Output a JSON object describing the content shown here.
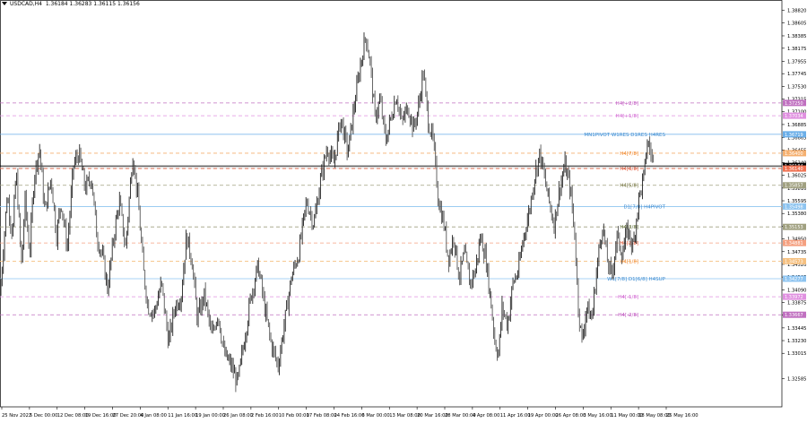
{
  "header": {
    "symbol_tf": "USDCAD,H4",
    "ohlc": "1.36184 1.36283 1.36115 1.36156"
  },
  "chart_data": {
    "type": "candlestick",
    "symbol": "USDCAD",
    "timeframe": "H4",
    "ylim": [
      1.322,
      1.389
    ],
    "y_ticks": [
      "1.38820",
      "1.38605",
      "1.38385",
      "1.38175",
      "1.37955",
      "1.37745",
      "1.37530",
      "1.37315",
      "1.37100",
      "1.36885",
      "1.36665",
      "1.36455",
      "1.36240",
      "1.36025",
      "1.35810",
      "1.35595",
      "1.35380",
      "1.35165",
      "1.34950",
      "1.34735",
      "1.34520",
      "1.34305",
      "1.34090",
      "1.33875",
      "1.33660",
      "1.33445",
      "1.33230",
      "1.33015",
      "1.32585"
    ],
    "x_ticks": [
      "25 Nov 2022",
      "5 Dec 00:00",
      "12 Dec 08:00",
      "19 Dec 16:00",
      "27 Dec 20:00",
      "4 Jan 08:00",
      "11 Jan 16:00",
      "19 Jan 00:00",
      "26 Jan 08:00",
      "2 Feb 16:00",
      "10 Feb 00:00",
      "17 Feb 08:00",
      "24 Feb 16:00",
      "6 Mar 00:00",
      "13 Mar 08:00",
      "20 Mar 16:00",
      "28 Mar 00:00",
      "4 Apr 08:00",
      "11 Apr 16:00",
      "19 Apr 00:00",
      "26 Apr 08:00",
      "3 May 16:00",
      "11 May 00:00",
      "18 May 08:00",
      "25 May 16:00"
    ],
    "path": [
      [
        0,
        1.34
      ],
      [
        8,
        1.357
      ],
      [
        14,
        1.35
      ],
      [
        18,
        1.361
      ],
      [
        24,
        1.345
      ],
      [
        28,
        1.356
      ],
      [
        33,
        1.347
      ],
      [
        38,
        1.36
      ],
      [
        44,
        1.365
      ],
      [
        50,
        1.354
      ],
      [
        57,
        1.36
      ],
      [
        63,
        1.35
      ],
      [
        68,
        1.356
      ],
      [
        75,
        1.348
      ],
      [
        82,
        1.362
      ],
      [
        88,
        1.364
      ],
      [
        95,
        1.358
      ],
      [
        102,
        1.36
      ],
      [
        108,
        1.35
      ],
      [
        115,
        1.346
      ],
      [
        120,
        1.341
      ],
      [
        127,
        1.35
      ],
      [
        133,
        1.356
      ],
      [
        140,
        1.348
      ],
      [
        148,
        1.364
      ],
      [
        154,
        1.356
      ],
      [
        160,
        1.344
      ],
      [
        165,
        1.338
      ],
      [
        172,
        1.337
      ],
      [
        180,
        1.342
      ],
      [
        188,
        1.332
      ],
      [
        195,
        1.338
      ],
      [
        202,
        1.34
      ],
      [
        208,
        1.35
      ],
      [
        214,
        1.346
      ],
      [
        220,
        1.336
      ],
      [
        228,
        1.34
      ],
      [
        236,
        1.333
      ],
      [
        243,
        1.337
      ],
      [
        250,
        1.33
      ],
      [
        258,
        1.328
      ],
      [
        265,
        1.325
      ],
      [
        272,
        1.332
      ],
      [
        280,
        1.34
      ],
      [
        288,
        1.345
      ],
      [
        295,
        1.338
      ],
      [
        302,
        1.332
      ],
      [
        310,
        1.328
      ],
      [
        318,
        1.336
      ],
      [
        325,
        1.343
      ],
      [
        333,
        1.347
      ],
      [
        342,
        1.356
      ],
      [
        350,
        1.352
      ],
      [
        358,
        1.36
      ],
      [
        365,
        1.365
      ],
      [
        372,
        1.362
      ],
      [
        380,
        1.37
      ],
      [
        388,
        1.364
      ],
      [
        395,
        1.372
      ],
      [
        402,
        1.379
      ],
      [
        408,
        1.384
      ],
      [
        413,
        1.379
      ],
      [
        418,
        1.37
      ],
      [
        424,
        1.373
      ],
      [
        430,
        1.366
      ],
      [
        436,
        1.37
      ],
      [
        442,
        1.374
      ],
      [
        448,
        1.369
      ],
      [
        455,
        1.372
      ],
      [
        461,
        1.368
      ],
      [
        467,
        1.372
      ],
      [
        472,
        1.378
      ],
      [
        477,
        1.37
      ],
      [
        483,
        1.366
      ],
      [
        489,
        1.356
      ],
      [
        495,
        1.352
      ],
      [
        500,
        1.346
      ],
      [
        506,
        1.35
      ],
      [
        512,
        1.343
      ],
      [
        518,
        1.347
      ],
      [
        524,
        1.342
      ],
      [
        530,
        1.344
      ],
      [
        536,
        1.35
      ],
      [
        542,
        1.346
      ],
      [
        548,
        1.338
      ],
      [
        552,
        1.332
      ],
      [
        556,
        1.33
      ],
      [
        560,
        1.338
      ],
      [
        566,
        1.335
      ],
      [
        572,
        1.342
      ],
      [
        578,
        1.344
      ],
      [
        584,
        1.35
      ],
      [
        590,
        1.354
      ],
      [
        596,
        1.36
      ],
      [
        602,
        1.364
      ],
      [
        607,
        1.36
      ],
      [
        612,
        1.356
      ],
      [
        618,
        1.352
      ],
      [
        624,
        1.358
      ],
      [
        630,
        1.362
      ],
      [
        636,
        1.358
      ],
      [
        641,
        1.35
      ],
      [
        645,
        1.338
      ],
      [
        649,
        1.332
      ],
      [
        654,
        1.338
      ],
      [
        660,
        1.336
      ],
      [
        666,
        1.345
      ],
      [
        672,
        1.352
      ],
      [
        677,
        1.346
      ],
      [
        682,
        1.343
      ],
      [
        688,
        1.35
      ],
      [
        694,
        1.347
      ],
      [
        700,
        1.351
      ],
      [
        706,
        1.348
      ],
      [
        712,
        1.356
      ],
      [
        718,
        1.36
      ],
      [
        722,
        1.366
      ],
      [
        726,
        1.364
      ],
      [
        730,
        1.3616
      ]
    ],
    "levels": [
      {
        "label": "H4[+2/8]",
        "price": "1.37250",
        "value": 1.3725,
        "color": "#c070c0",
        "dash": true,
        "label_color": "#c050c0"
      },
      {
        "label": "H4[+1/8]",
        "price": "1.37034",
        "value": 1.37034,
        "color": "#e090e0",
        "dash": true,
        "label_color": "#d060d0"
      },
      {
        "label": "MN1PIVOT W1RES D1RES H4RES",
        "price": "1.36719",
        "value": 1.36719,
        "color": "#6aaee8",
        "dash": false,
        "label_color": "#3a8ad0"
      },
      {
        "label": "H4[7/8]",
        "price": "1.36400",
        "value": 1.364,
        "color": "#f5b070",
        "dash": true,
        "label_color": "#f08020"
      },
      {
        "label": "",
        "price": "1.36184",
        "value": 1.36184,
        "color": "#000000",
        "dash": false,
        "label_color": "#000"
      },
      {
        "label": "H4[6/8]",
        "price": "1.36140",
        "value": 1.3614,
        "color": "#f07050",
        "dash": true,
        "label_color": "#e05030"
      },
      {
        "label": "H4[5/8]",
        "price": "1.35857",
        "value": 1.35857,
        "color": "#a0a080",
        "dash": true,
        "label_color": "#6a6a30"
      },
      {
        "label": "D1[7/8] H4PIVOT",
        "price": "1.35498",
        "value": 1.35498,
        "color": "#8ec4f0",
        "dash": false,
        "label_color": "#3a8ad0"
      },
      {
        "label": "H4[3/8]",
        "price": "1.35153",
        "value": 1.35153,
        "color": "#a0a080",
        "dash": true,
        "label_color": "#5a6a30"
      },
      {
        "label": "H4[2/8]",
        "price": "1.34881",
        "value": 1.34881,
        "color": "#f5a080",
        "dash": true,
        "label_color": "#e05030"
      },
      {
        "label": "H4[1/8]",
        "price": "1.34573",
        "value": 1.34573,
        "color": "#f5c080",
        "dash": true,
        "label_color": "#f08020"
      },
      {
        "label": "W1[7/8] D1[6/8] H4SUP",
        "price": "1.34277",
        "value": 1.34277,
        "color": "#8ec4f0",
        "dash": false,
        "label_color": "#3a8ad0"
      },
      {
        "label": "H4[-1/8]",
        "price": "1.33972",
        "value": 1.33972,
        "color": "#e090e0",
        "dash": true,
        "label_color": "#d060d0"
      },
      {
        "label": "H4[-2/8]",
        "price": "1.33667",
        "value": 1.33667,
        "color": "#c070c0",
        "dash": true,
        "label_color": "#c050c0"
      }
    ]
  }
}
